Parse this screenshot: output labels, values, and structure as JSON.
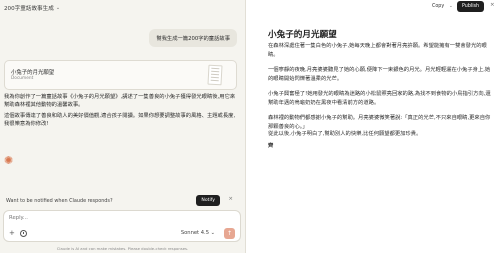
{
  "chat": {
    "title": "200字童話故事生成",
    "user_message": "幫我生成一篇200字的童話故事",
    "artifact": {
      "title": "小兔子的月光願望",
      "type": "Document"
    },
    "response_paragraphs": [
      "我為你創作了一篇童話故事《小兔子的月光願望》,講述了一隻善良的小兔子獲得發光眼睛後,用它來幫助森林裡其他動物的溫馨故事。",
      "這個故事傳達了善良和助人的美好價值觀,適合孩子閱讀。如果你想要調整故事的風格、主題或長度,我很樂意為你修改!"
    ],
    "notify": {
      "text": "Want to be notified when Claude responds?",
      "button": "Notify"
    },
    "composer": {
      "placeholder": "Reply...",
      "model": "Sonnet 4.5"
    },
    "disclaimer": "Claude is AI and can make mistakes. Please double-check responses."
  },
  "doc": {
    "copy_label": "Copy",
    "publish_label": "Publish",
    "title": "小兔子的月光願望",
    "paragraphs": [
      "在森林深處住著一隻白色的小兔子,她每天晚上都會對著月亮許願。希望能擁有一雙會發光的眼睛。",
      "一個寧靜的夜晚,月亮婆婆聽見了她的心願,便降下一束銀色的月光。月光輕輕灑在小兔子身上,她的眼睛開始閃爍著溫柔的光芒。",
      "小兔子興奮極了!她用發光的眼睛為迷路的小松鼠照亮回家的路,為找不到食物的小鳥指引方向,還幫助年邁的烏龜奶奶在黑夜中看清前方的道路。",
      "森林裡的動物們都感謝小兔子的幫助。月亮婆婆微笑著說:「真正的光芒,不只來自眼睛,更來自你那顆善良的心。」",
      "從此以後,小兔子明白了,幫助別人的快樂,比任何願望都更加珍貴。",
      "齊"
    ]
  },
  "icons": {
    "chat_title_chevron": "chevron-down-icon",
    "spark": "claude-spark-icon",
    "plus": "plus-icon",
    "clock": "clock-icon",
    "send": "arrow-up-icon",
    "close": "close-icon"
  },
  "colors": {
    "accent": "#d9774f",
    "send_button": "#e7a792",
    "dark_button": "#1f1f1f",
    "chat_background": "#f5f4ef",
    "doc_background": "#ffffff"
  }
}
